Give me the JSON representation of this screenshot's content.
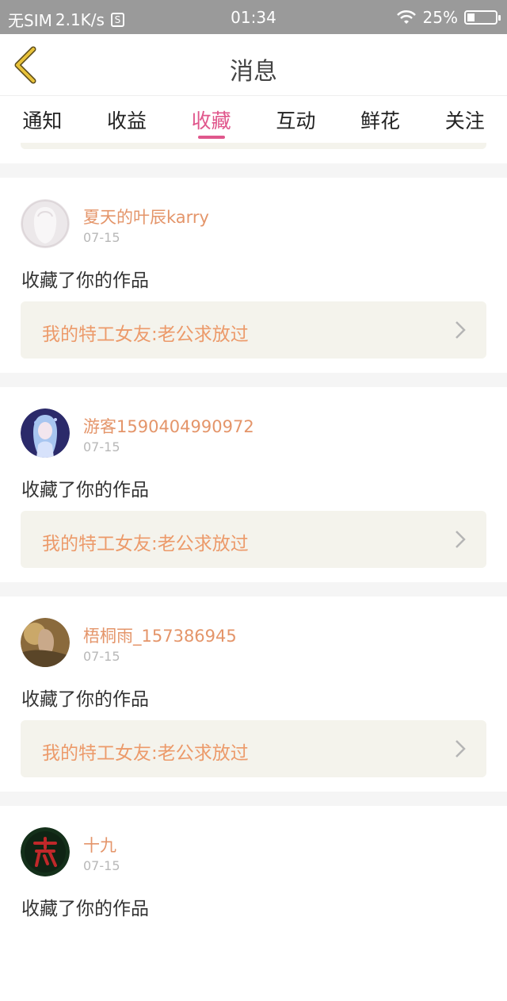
{
  "status_bar": {
    "carrier": "无SIM",
    "speed": "2.1K/s",
    "sim_badge": "S",
    "time": "01:34",
    "battery": "25%",
    "battery_level": 0.25
  },
  "nav": {
    "title": "消息"
  },
  "tabs": [
    {
      "label": "通知",
      "active": false
    },
    {
      "label": "收益",
      "active": false
    },
    {
      "label": "收藏",
      "active": true
    },
    {
      "label": "互动",
      "active": false
    },
    {
      "label": "鲜花",
      "active": false
    },
    {
      "label": "关注",
      "active": false
    }
  ],
  "messages": [
    {
      "username": "夏天的叶辰karry",
      "date": "07-15",
      "action": "收藏了你的作品",
      "work_title": "我的特工女友:老公求放过"
    },
    {
      "username": "游客1590404990972",
      "date": "07-15",
      "action": "收藏了你的作品",
      "work_title": "我的特工女友:老公求放过"
    },
    {
      "username": "梧桐雨_157386945",
      "date": "07-15",
      "action": "收藏了你的作品",
      "work_title": "我的特工女友:老公求放过"
    },
    {
      "username": "十九",
      "date": "07-15",
      "action": "收藏了你的作品",
      "work_title": ""
    }
  ],
  "colors": {
    "accent": "#e0578c",
    "username": "#e4956a",
    "work_title": "#ec9a6a",
    "back_arrow": "#e8c23a",
    "status_bar": "#9a9a9a"
  }
}
